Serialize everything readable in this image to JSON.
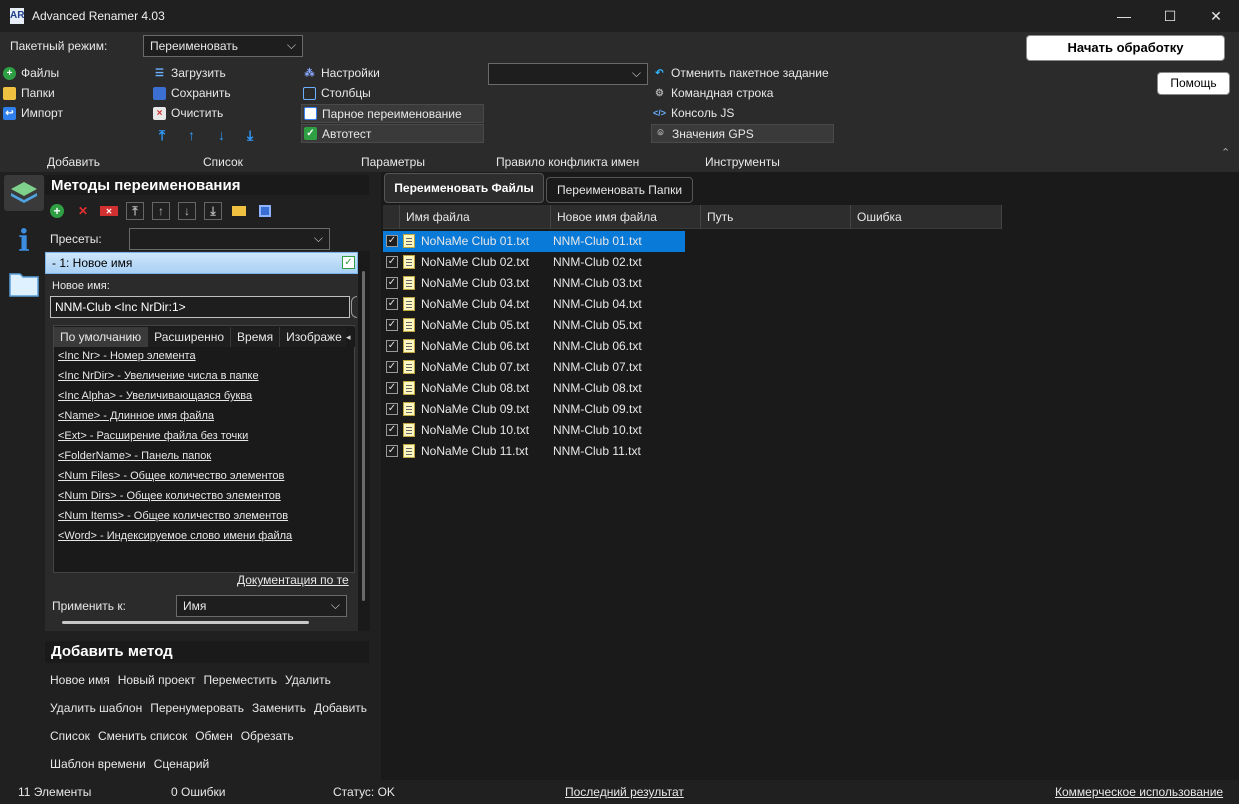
{
  "window": {
    "title": "Advanced Renamer 4.03",
    "controls": {
      "minimize": "—",
      "maximize": "☐",
      "close": "✕"
    }
  },
  "batch": {
    "label": "Пакетный режим:",
    "value": "Переименовать",
    "start_button": "Начать обработку",
    "help_button": "Помощь"
  },
  "add_group": {
    "label": "Добавить",
    "files": "Файлы",
    "folders": "Папки",
    "import": "Импорт"
  },
  "list_group": {
    "label": "Список",
    "load": "Загрузить",
    "save": "Сохранить",
    "clear": "Очистить",
    "arrows": [
      "⤒",
      "↑",
      "↓",
      "⤓"
    ]
  },
  "params_group": {
    "label": "Параметры",
    "settings": "Настройки",
    "columns": "Столбцы",
    "pair_rename": "Парное переименование",
    "autotest": "Автотест"
  },
  "conflict_group": {
    "label": "Правило конфликта имен",
    "value": ""
  },
  "tools_group": {
    "label": "Инструменты",
    "cancel_batch": "Отменить пакетное задание",
    "command_line": "Командная строка",
    "js_console": "Консоль JS",
    "gps_values": "Значения GPS"
  },
  "methods_panel": {
    "title": "Методы переименования",
    "presets_label": "Пресеты:",
    "presets_value": "",
    "method_header": "-  1: Новое имя",
    "new_name_label": "Новое имя:",
    "new_name_value": "NNM-Club <Inc NrDir:1>",
    "tabs": [
      "По умолчанию",
      "Расширенно",
      "Время",
      "Изображе"
    ],
    "tags": [
      "<Inc Nr> - Номер элемента",
      "<Inc NrDir> - Увеличение числа в папке",
      "<Inc Alpha> - Увеличивающаяся буква",
      "<Name> - Длинное имя файла",
      "<Ext> - Расширение файла без точки",
      "<FolderName> - Панель папок",
      "<Num Files> - Общее количество элементов",
      "<Num Dirs> - Общее количество элементов",
      "<Num Items> - Общее количество элементов",
      "<Word> - Индексируемое слово имени файла"
    ],
    "docs_link": "Документация по те",
    "apply_label": "Применить к:",
    "apply_value": "Имя"
  },
  "add_method": {
    "title": "Добавить метод",
    "rows": [
      [
        "Новое имя",
        "Новый проект",
        "Переместить",
        "Удалить"
      ],
      [
        "Удалить шаблон",
        "Перенумеровать",
        "Заменить",
        "Добавить"
      ],
      [
        "Список",
        "Сменить список",
        "Обмен",
        "Обрезать"
      ],
      [
        "Шаблон времени",
        "Сценарий"
      ]
    ]
  },
  "file_tabs": {
    "rename_files": "Переименовать Файлы",
    "rename_folders": "Переименовать Папки"
  },
  "grid": {
    "columns": [
      "Имя файла",
      "Новое имя файла",
      "Путь",
      "Ошибка"
    ],
    "rows": [
      {
        "name": "NoNaMe Club 01.txt",
        "new": "NNM-Club 01.txt",
        "checked": true,
        "selected": true
      },
      {
        "name": "NoNaMe Club 02.txt",
        "new": "NNM-Club 02.txt",
        "checked": true
      },
      {
        "name": "NoNaMe Club 03.txt",
        "new": "NNM-Club 03.txt",
        "checked": true
      },
      {
        "name": "NoNaMe Club 04.txt",
        "new": "NNM-Club 04.txt",
        "checked": true
      },
      {
        "name": "NoNaMe Club 05.txt",
        "new": "NNM-Club 05.txt",
        "checked": true
      },
      {
        "name": "NoNaMe Club 06.txt",
        "new": "NNM-Club 06.txt",
        "checked": true
      },
      {
        "name": "NoNaMe Club 07.txt",
        "new": "NNM-Club 07.txt",
        "checked": true
      },
      {
        "name": "NoNaMe Club 08.txt",
        "new": "NNM-Club 08.txt",
        "checked": true
      },
      {
        "name": "NoNaMe Club 09.txt",
        "new": "NNM-Club 09.txt",
        "checked": true
      },
      {
        "name": "NoNaMe Club 10.txt",
        "new": "NNM-Club 10.txt",
        "checked": true
      },
      {
        "name": "NoNaMe Club 11.txt",
        "new": "NNM-Club 11.txt",
        "checked": true
      }
    ]
  },
  "status": {
    "items": "11 Элементы",
    "errors": "0 Ошибки",
    "status": "Статус: OK",
    "last_result": "Последний результат",
    "commercial": "Коммерческое использование"
  },
  "colors": {
    "selection": "#0a7ad8",
    "background": "#202020",
    "panel": "#2b2b2b"
  }
}
